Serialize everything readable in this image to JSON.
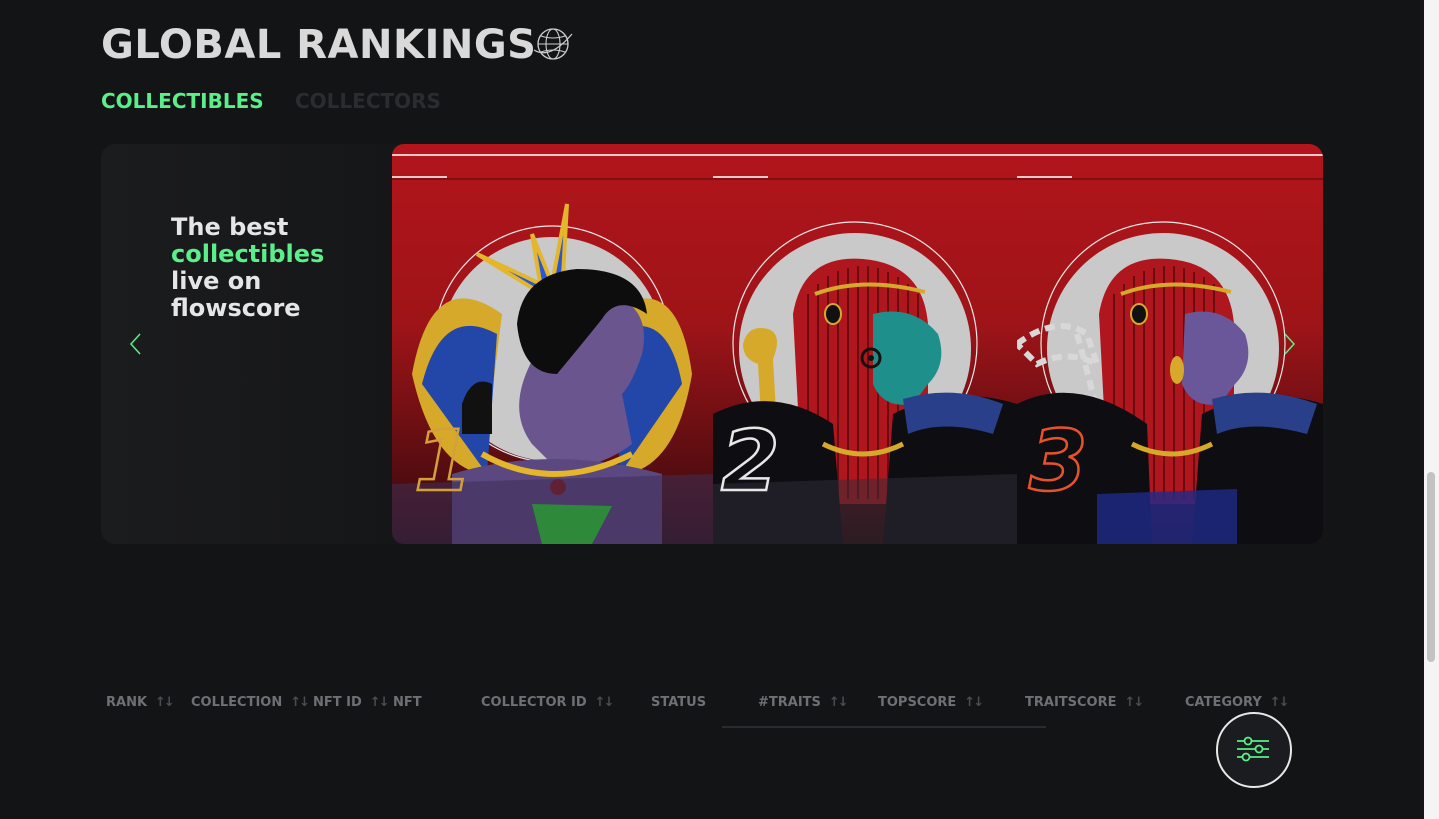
{
  "header": {
    "title": "GLOBAL RANKINGS",
    "globe_icon": "globe-icon"
  },
  "tabs": [
    {
      "label": "COLLECTIBLES",
      "active": true
    },
    {
      "label": "COLLECTORS",
      "active": false
    }
  ],
  "hero": {
    "line1": "The best",
    "line2": "collectibles",
    "line3": "live on",
    "line4": "flowscore",
    "prev_icon": "chevron-left-icon",
    "next_icon": "chevron-right-icon",
    "cards": [
      {
        "rank": "1",
        "accent": "#d4a03a"
      },
      {
        "rank": "2",
        "accent": "#e7e7e7"
      },
      {
        "rank": "3",
        "accent": "#e8522a"
      }
    ]
  },
  "table": {
    "columns": [
      {
        "label": "RANK",
        "sortable": true
      },
      {
        "label": "COLLECTION",
        "sortable": true
      },
      {
        "label": "NFT ID",
        "sortable": true
      },
      {
        "label": "NFT",
        "sortable": false
      },
      {
        "label": "COLLECTOR ID",
        "sortable": true
      },
      {
        "label": "STATUS",
        "sortable": false
      },
      {
        "label": "#TRAITS",
        "sortable": true
      },
      {
        "label": "TOPSCORE",
        "sortable": true
      },
      {
        "label": "TRAITSCORE",
        "sortable": true
      },
      {
        "label": "CATEGORY",
        "sortable": true
      }
    ],
    "sort_glyph": "↑↓"
  },
  "filter_button": {
    "icon": "sliders-icon"
  },
  "colors": {
    "accent_green": "#5bef8a",
    "background": "#131416",
    "card_red": "#b2151b"
  }
}
